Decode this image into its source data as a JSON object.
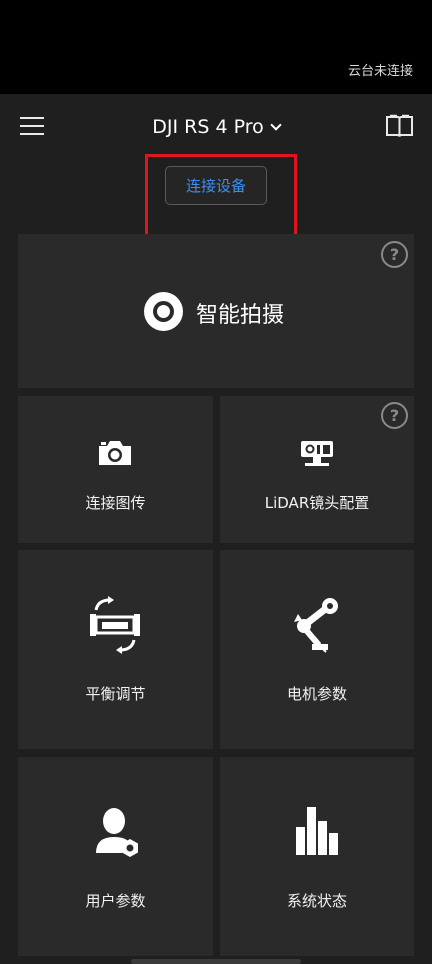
{
  "status_bar": {
    "gimbal_status": "云台未连接"
  },
  "header": {
    "device_name": "DJI RS 4 Pro",
    "connect_button": "连接设备"
  },
  "tiles": {
    "smart_capture": "智能拍摄",
    "connect_image_transmission": "连接图传",
    "lidar_config": "LiDAR镜头配置",
    "balance_adjust": "平衡调节",
    "motor_params": "电机参数",
    "user_params": "用户参数",
    "system_status": "系统状态"
  },
  "icons": {
    "menu": "hamburger-menu-icon",
    "manual": "book-icon",
    "help": "question-mark-icon"
  },
  "colors": {
    "accent_blue": "#3d8ef0",
    "highlight_red": "#e0141c",
    "tile_bg": "#2a2a2a",
    "page_bg": "#1f1f1f"
  }
}
